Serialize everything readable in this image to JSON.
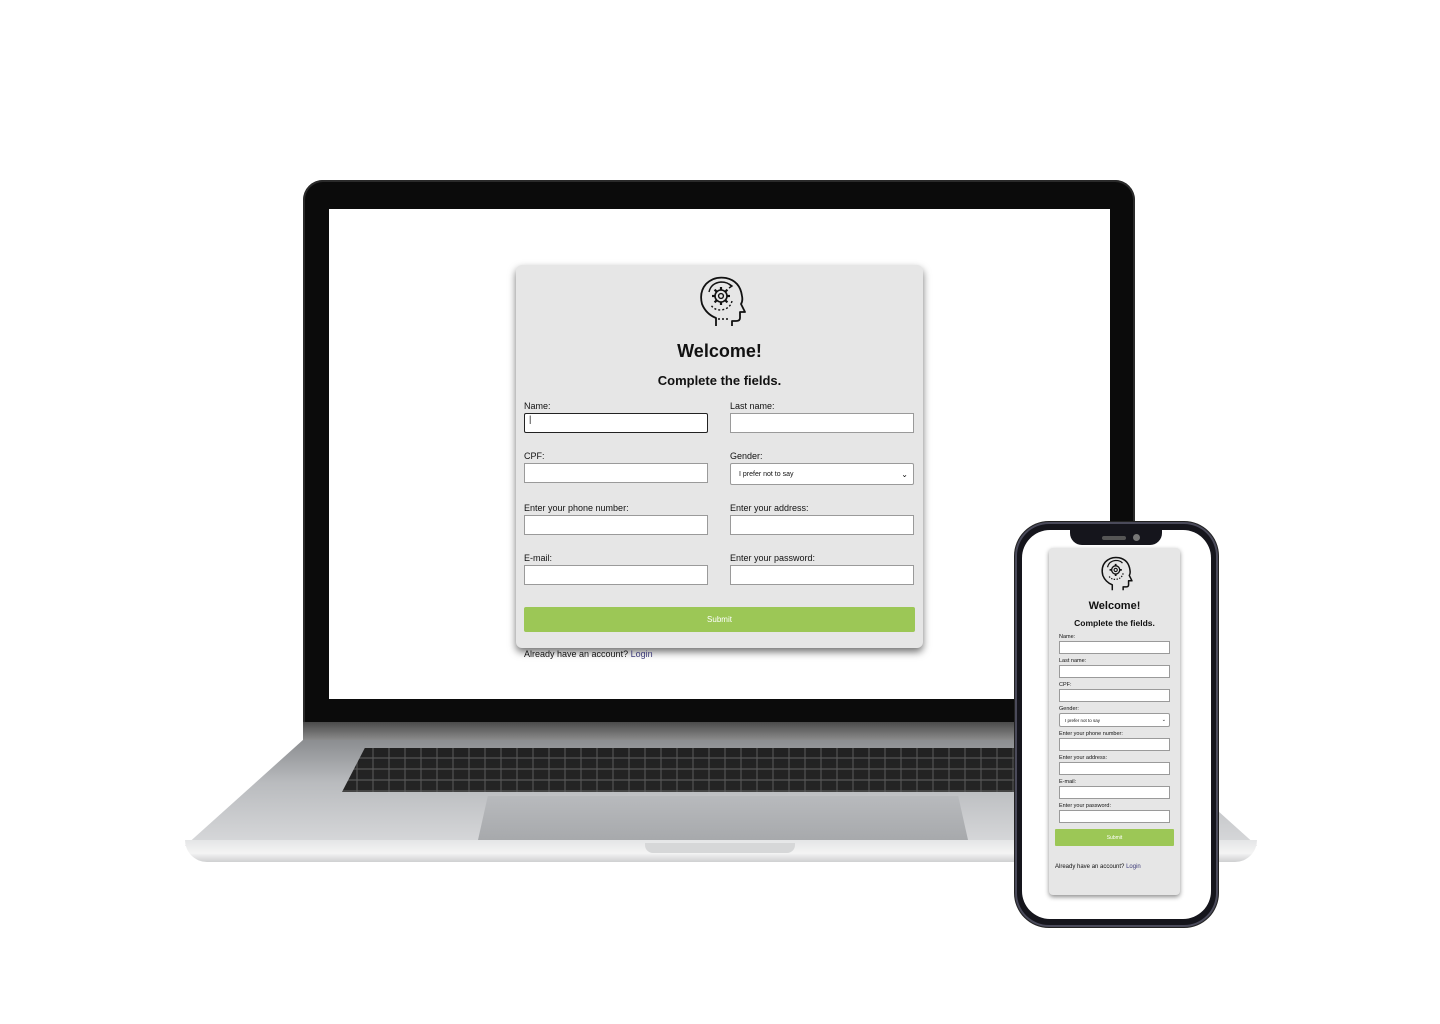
{
  "form": {
    "welcome": "Welcome!",
    "subtitle": "Complete the fields.",
    "name_label": "Name:",
    "name_value": "|",
    "last_name_label": "Last name:",
    "cpf_label": "CPF:",
    "gender_label": "Gender:",
    "gender_selected": "I prefer not to say",
    "phone_label": "Enter your phone number:",
    "address_label": "Enter your address:",
    "email_label": "E-mail:",
    "password_label": "Enter your password:",
    "submit_label": "Submit",
    "footer_text": "Already have an account?",
    "login_link": "Login"
  },
  "colors": {
    "card_bg": "#e6e6e6",
    "submit_bg": "#9cc756",
    "link": "#3d3b78"
  },
  "icons": {
    "logo": "head-with-gear-icon",
    "select_arrow": "chevron-down-icon"
  }
}
